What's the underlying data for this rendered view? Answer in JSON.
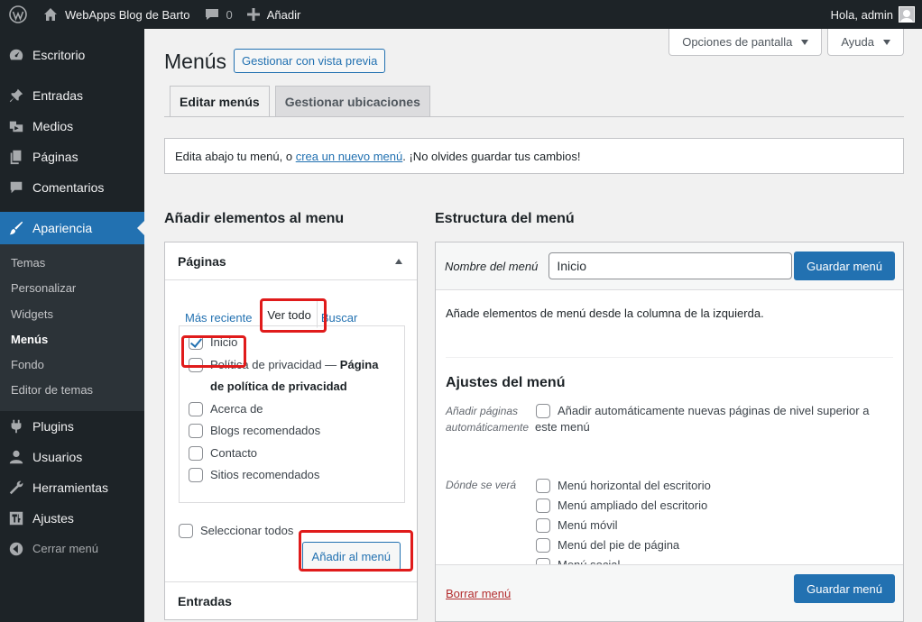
{
  "adminbar": {
    "site_name": "WebApps Blog de Barto",
    "comments_count": "0",
    "new_label": "Añadir",
    "greeting": "Hola, admin"
  },
  "sidebar": {
    "items": [
      {
        "label": "Escritorio",
        "icon": "dashboard-icon"
      },
      {
        "label": "Entradas",
        "icon": "pushpin-icon"
      },
      {
        "label": "Medios",
        "icon": "media-icon"
      },
      {
        "label": "Páginas",
        "icon": "pages-icon"
      },
      {
        "label": "Comentarios",
        "icon": "comments-icon"
      },
      {
        "label": "Apariencia",
        "icon": "brush-icon"
      },
      {
        "label": "Plugins",
        "icon": "plugin-icon"
      },
      {
        "label": "Usuarios",
        "icon": "users-icon"
      },
      {
        "label": "Herramientas",
        "icon": "tools-icon"
      },
      {
        "label": "Ajustes",
        "icon": "settings-icon"
      },
      {
        "label": "Cerrar menú",
        "icon": "collapse-icon"
      }
    ],
    "submenu": [
      "Temas",
      "Personalizar",
      "Widgets",
      "Menús",
      "Fondo",
      "Editor de temas"
    ]
  },
  "screen_options": {
    "label": "Opciones de pantalla"
  },
  "help": {
    "label": "Ayuda"
  },
  "page": {
    "title": "Menús",
    "preview_label": "Gestionar con vista previa",
    "tabs": [
      "Editar menús",
      "Gestionar ubicaciones"
    ]
  },
  "notice": {
    "before": "Edita abajo tu menú, o ",
    "link": "crea un nuevo menú",
    "after": ". ¡No olvides guardar tus cambios!"
  },
  "left": {
    "heading": "Añadir elementos al menu",
    "section_title": "Páginas",
    "tabs": [
      "Más reciente",
      "Ver todo",
      "Buscar"
    ],
    "pages": [
      {
        "label": "Inicio",
        "checked": true
      },
      {
        "label": "Política de privacidad — ",
        "suffix": "Página de política de privacidad",
        "checked": false
      },
      {
        "label": "Acerca de",
        "checked": false
      },
      {
        "label": "Blogs recomendados",
        "checked": false
      },
      {
        "label": "Contacto",
        "checked": false
      },
      {
        "label": "Sitios recomendados",
        "checked": false
      }
    ],
    "select_all": "Seleccionar todos",
    "add_button": "Añadir al menú",
    "next_section": "Entradas"
  },
  "right": {
    "heading": "Estructura del menú",
    "name_label": "Nombre del menú",
    "name_value": "Inicio",
    "save_label": "Guardar menú",
    "intro": "Añade elementos de menú desde la columna de la izquierda.",
    "settings_title": "Ajustes del menú",
    "auto_label": "Añadir páginas automáticamente",
    "auto_option_line1": "Añadir automáticamente nuevas páginas de nivel superior a",
    "auto_option_line2": "este menú",
    "location_label": "Dónde se verá",
    "locations": [
      "Menú horizontal del escritorio",
      "Menú ampliado del escritorio",
      "Menú móvil",
      "Menú del pie de página",
      "Menú social"
    ],
    "delete_label": "Borrar menú"
  },
  "colors": {
    "admin_dark": "#1d2327",
    "accent_blue": "#2271b1",
    "highlight_red": "#e01b1b"
  }
}
